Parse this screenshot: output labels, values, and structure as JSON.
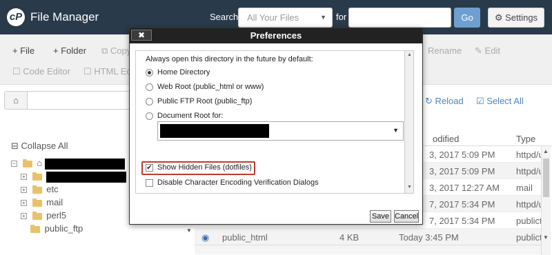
{
  "header": {
    "logo_text": "cP",
    "title": "File Manager",
    "search_label": "Search",
    "search_scope": "All Your Files",
    "for_label": "for",
    "search_value": "",
    "go_label": "Go",
    "settings_label": "Settings"
  },
  "toolbar": {
    "file": "File",
    "folder": "Folder",
    "copy": "Copy",
    "rename": "Rename",
    "edit": "Edit",
    "code_editor": "Code Editor",
    "html_editor": "HTML Ed"
  },
  "pathbar": {
    "reload": "Reload",
    "select_all": "Select All"
  },
  "tree": {
    "collapse_all": "Collapse All",
    "folders": [
      {
        "label": "etc"
      },
      {
        "label": "mail"
      },
      {
        "label": "perl5"
      },
      {
        "label": "public_ftp"
      }
    ]
  },
  "table": {
    "col_modified": "odified",
    "col_type": "Type",
    "rows": [
      {
        "modified": "3, 2017 5:09 PM",
        "type": "httpd/u"
      },
      {
        "modified": "3, 2017 5:09 PM",
        "type": "httpd/u"
      },
      {
        "modified": "3, 2017 12:27 AM",
        "type": "mail"
      },
      {
        "modified": "7, 2017 5:34 PM",
        "type": "httpd/u"
      },
      {
        "modified": "7, 2017 5:34 PM",
        "type": "publict"
      },
      {
        "name": "public_html",
        "size": "4 KB",
        "modified": "Today 3:45 PM",
        "type": "publict"
      }
    ]
  },
  "preferences": {
    "title": "Preferences",
    "close_label": "✖",
    "intro": "Always open this directory in the future by default:",
    "options": [
      {
        "label": "Home Directory",
        "selected": true
      },
      {
        "label": "Web Root (public_html or www)",
        "selected": false
      },
      {
        "label": "Public FTP Root (public_ftp)",
        "selected": false
      },
      {
        "label": "Document Root for:",
        "selected": false
      }
    ],
    "show_hidden": {
      "label": "Show Hidden Files (dotfiles)",
      "checked": true
    },
    "disable_encoding": {
      "label": "Disable Character Encoding Verification Dialogs",
      "checked": false
    },
    "save_label": "Save",
    "cancel_label": "Cancel",
    "highlight_color": "#c0392b"
  }
}
